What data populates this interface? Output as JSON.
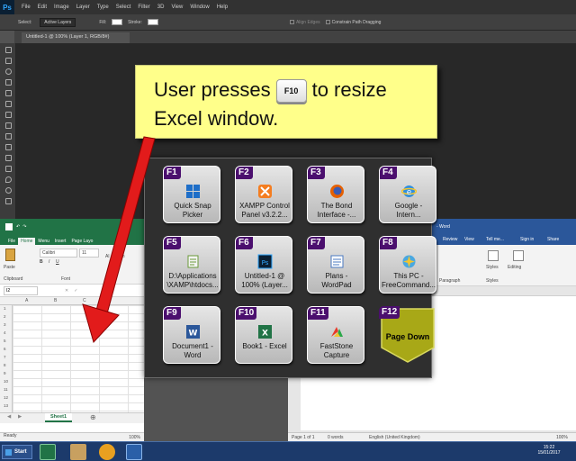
{
  "photoshop": {
    "logo": "Ps",
    "menu": [
      "File",
      "Edit",
      "Image",
      "Layer",
      "Type",
      "Select",
      "Filter",
      "3D",
      "View",
      "Window",
      "Help"
    ],
    "options": {
      "select_label": "Select:",
      "select_value": "Active Layers",
      "fill_label": "Fill:",
      "stroke_label": "Stroke:",
      "align_edges": "Align Edges",
      "constrain_label": "Constrain Path Dragging"
    },
    "doc_tab": "Untitled-1 @ 100% (Layer 1, RGB/8#)"
  },
  "excel": {
    "tabs": [
      "File",
      "Home",
      "Menu",
      "Insert",
      "Page Layo"
    ],
    "ribbon": {
      "font_name": "Calibri",
      "font_size": "11",
      "paste": "Paste",
      "clipboard": "Clipboard",
      "font_group": "Font",
      "al": "Al",
      "num": "Num"
    },
    "name_box": "I2",
    "columns": [
      "A",
      "B",
      "C"
    ],
    "rows": [
      "1",
      "2",
      "3",
      "4",
      "5",
      "6",
      "7",
      "8",
      "9",
      "10",
      "11",
      "12",
      "13"
    ],
    "sheet_tab": "Sheet1",
    "status": "Ready",
    "zoom": "100%"
  },
  "word": {
    "title": "- Word",
    "tabs": {
      "review": "Review",
      "view": "View",
      "tell": "Tell me...",
      "signin": "Sign in",
      "share": "Share"
    },
    "ribbon": {
      "styles": "Styles",
      "editing": "Editing",
      "paragraph": "Paragraph",
      "styles_group": "Styles"
    },
    "status": {
      "page": "Page 1 of 1",
      "words": "0 words",
      "lang": "English (United Kingdom)",
      "zoom": "100%"
    }
  },
  "taskbar": {
    "start": "Start",
    "time": "15:22",
    "date": "15/01/2017"
  },
  "callout": {
    "line1_pre": "User presses",
    "key": "F10",
    "line1_post": "to resize",
    "line2": "Excel window."
  },
  "launcher": {
    "tiles": [
      {
        "key": "F1",
        "label": "Quick Snap Picker",
        "icon": "windows-grid-icon"
      },
      {
        "key": "F2",
        "label": "XAMPP Control Panel v3.2.2...",
        "icon": "xampp-icon"
      },
      {
        "key": "F3",
        "label": "The Bond Interface -...",
        "icon": "firefox-icon"
      },
      {
        "key": "F4",
        "label": "Google - Intern...",
        "icon": "internet-explorer-icon"
      },
      {
        "key": "F5",
        "label": "D:\\Applications \\XAMP\\htdocs...",
        "icon": "notepad-icon"
      },
      {
        "key": "F6",
        "label": "Untitled-1 @ 100% (Layer...",
        "icon": "photoshop-icon"
      },
      {
        "key": "F7",
        "label": "Plans - WordPad",
        "icon": "wordpad-icon"
      },
      {
        "key": "F8",
        "label": "This PC - FreeCommand...",
        "icon": "freecommander-icon"
      },
      {
        "key": "F9",
        "label": "Document1 - Word",
        "icon": "word-icon"
      },
      {
        "key": "F10",
        "label": "Book1 - Excel",
        "icon": "excel-icon"
      },
      {
        "key": "F11",
        "label": "FastStone Capture",
        "icon": "faststone-icon"
      },
      {
        "key": "F12",
        "label": "Page Down",
        "icon": "page-down-icon"
      }
    ]
  },
  "colors": {
    "excel_green": "#217346",
    "word_blue": "#2b579a",
    "fkey_purple": "#4b0f6e",
    "callout_yellow": "#ffff8a",
    "page_down_olive": "#a8a817",
    "arrow_red": "#e21b1b"
  }
}
